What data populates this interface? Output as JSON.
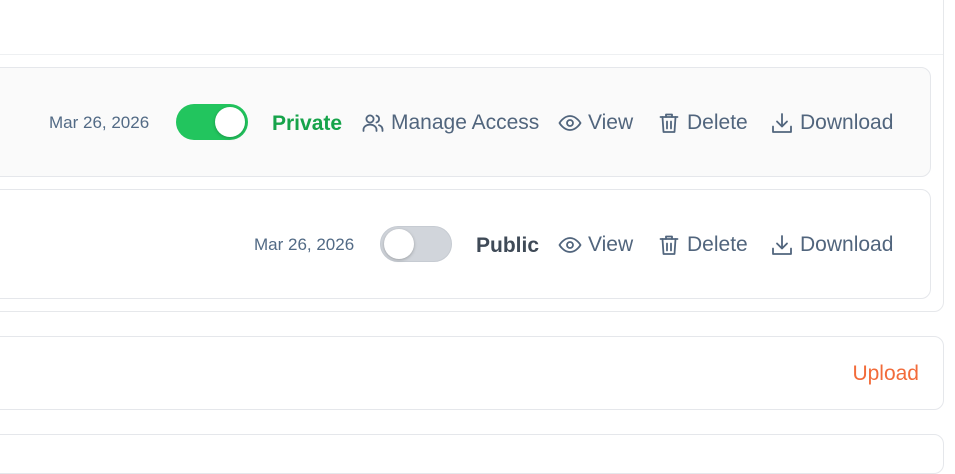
{
  "files": [
    {
      "date": "Mar 26, 2026",
      "toggle_on": true,
      "status": "Private",
      "actions": {
        "manage_access": "Manage Access",
        "view": "View",
        "delete": "Delete",
        "download": "Download"
      }
    },
    {
      "date": "Mar 26, 2026",
      "toggle_on": false,
      "status": "Public",
      "actions": {
        "view": "View",
        "delete": "Delete",
        "download": "Download"
      }
    }
  ],
  "upload": {
    "label": "Upload"
  },
  "colors": {
    "toggle_on": "#22c55e",
    "toggle_off": "#d1d5db",
    "private": "#16a34a",
    "public": "#3f4a57",
    "action": "#51657d",
    "upload": "#f26b3a"
  },
  "icons": [
    "users-icon",
    "eye-icon",
    "trash-icon",
    "download-icon"
  ]
}
